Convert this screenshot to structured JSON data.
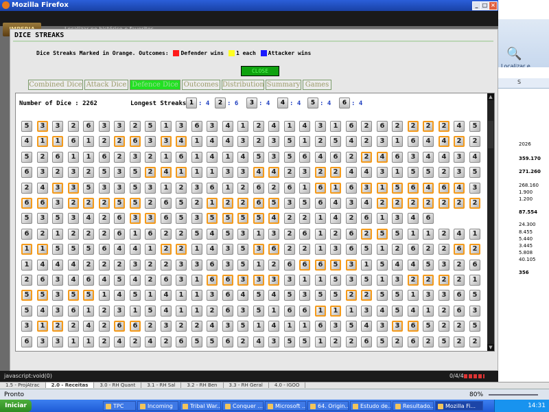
{
  "window": {
    "title": "Mozilla Firefox"
  },
  "toolbar": {
    "site_logo": "IMPERIA",
    "search_hint": "Localizar no histórico e favoritos"
  },
  "dialog": {
    "title": "DICE STREAKS",
    "legend_prefix": "Dice Streaks Marked in Orange. Outcomes:",
    "legend_items": [
      {
        "color": "#ff1a1a",
        "label": "Defender wins"
      },
      {
        "color": "#ffff22",
        "label": "1 each"
      },
      {
        "color": "#1a1aff",
        "label": "Attacker wins"
      }
    ],
    "close_label": "CLOSE",
    "tabs": [
      "Combined Dice",
      "Attack Dice",
      "Defence Dice",
      "Outcomes",
      "Distribution",
      "Summary",
      "Games"
    ],
    "active_tab": "Defence Dice",
    "number_of_dice_label": "Number of Dice : 2262",
    "longest_label": "Longest Streaks:",
    "longest_streaks": [
      {
        "face": "1",
        "value": ": 4"
      },
      {
        "face": "2",
        "value": ": 6"
      },
      {
        "face": "3",
        "value": ": 4"
      },
      {
        "face": "4",
        "value": ": 4"
      },
      {
        "face": "5",
        "value": ": 4"
      },
      {
        "face": "6",
        "value": ": 4"
      }
    ],
    "streak_color": "#f49a1a",
    "dice_rows": [
      "533263325136341241431626222245",
      "411612263341443235125423164422",
      "526116232161414535646224634434",
      "632325352411133442322443155235",
      "243353353123612626161631564643",
      "663222552652122653564342222222",
      "535342633653555542214261346",
      "621222616225453132612625511241",
      "115556441221435362213651262262",
      "144422232233635126665315445326",
      "263464542631663333115351322221",
      "553551451411364545355225513365",
      "543612315411263516611134541263",
      "312242662322435141163543365225",
      "633112424265562435512265262522"
    ],
    "dice_streaks": [
      "010000000000000000000000011100",
      "011000110110000000000000000110",
      "000000000000000000000011000000",
      "000000001110000110011000000000",
      "001100000000000000011011111110",
      "110111110000111110000001111111",
      "000000011000111110000000000011",
      "000000000000000000000011000000",
      "110000000110000110000000000011",
      "000000000000000000111100000000",
      "000000000000111110000000011100",
      "110110000000000000000110000000",
      "000000000000000000011000000000",
      "011000110000000000000000110000",
      "000000000000000000000000000000"
    ]
  },
  "excel": {
    "find_label": "Localizar e Selecionar",
    "column": "S",
    "cells": [
      "2026",
      "359.170",
      "271.260",
      "268.160",
      "1.900",
      "1.200",
      "87.554",
      "24.300",
      "8.455",
      "5.440",
      "3.445",
      "5.808",
      "40.105",
      "356"
    ],
    "sheet_tabs": [
      "1.5 - ProjAtrac",
      "2.0 - Receitas",
      "3.0 - RH Quant",
      "3.1 - RH Sal",
      "3.2 - RH Ben",
      "3.3 - RH Geral",
      "4.0 - IGOO"
    ],
    "active_sheet": "2.0 - Receitas",
    "status": "Pronto",
    "zoom": "80%"
  },
  "status": {
    "text": "javascript:void(0)",
    "count": "0/4/4"
  },
  "taskbar": {
    "start": "Iniciar",
    "items": [
      "TPC",
      "Incoming",
      "Tribal War...",
      "Conquer ...",
      "Microsoft ...",
      "64. Origin...",
      "Estudo de...",
      "Resultado...",
      "Mozilla Fi..."
    ],
    "active": "Mozilla Fi...",
    "clock": "14:31"
  }
}
